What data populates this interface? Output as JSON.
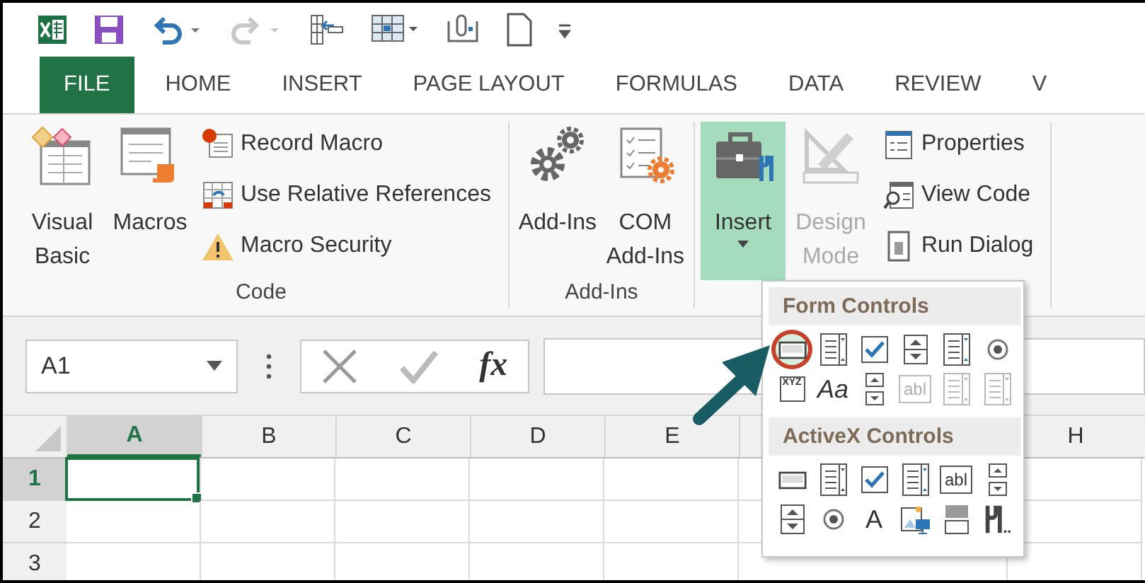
{
  "quick_access": [
    {
      "kind": "excel-logo",
      "disabled": false
    },
    {
      "kind": "save",
      "disabled": false
    },
    {
      "kind": "undo",
      "disabled": false
    },
    {
      "kind": "redo",
      "disabled": true
    },
    {
      "kind": "form",
      "disabled": false
    },
    {
      "kind": "table",
      "disabled": false
    },
    {
      "kind": "touch",
      "disabled": false
    },
    {
      "kind": "new-document",
      "disabled": false
    },
    {
      "kind": "customize",
      "disabled": false
    }
  ],
  "ribbon_tabs": [
    {
      "label": "FILE",
      "kind": "file"
    },
    {
      "label": "HOME",
      "kind": "tab"
    },
    {
      "label": "INSERT",
      "kind": "tab"
    },
    {
      "label": "PAGE LAYOUT",
      "kind": "tab"
    },
    {
      "label": "FORMULAS",
      "kind": "tab"
    },
    {
      "label": "DATA",
      "kind": "tab"
    },
    {
      "label": "REVIEW",
      "kind": "tab"
    },
    {
      "label": "V",
      "kind": "tab"
    }
  ],
  "groups": [
    {
      "label": "Code",
      "large_buttons": [
        {
          "label": "Visual Basic",
          "kind": "visual-basic",
          "selected": false,
          "disabled": false,
          "has_menu": false
        },
        {
          "label": "Macros",
          "kind": "macros",
          "selected": false,
          "disabled": false,
          "has_menu": false
        }
      ],
      "small_buttons": [
        {
          "label": "Record Macro",
          "kind": "record"
        },
        {
          "label": "Use Relative References",
          "kind": "relative"
        },
        {
          "label": "Macro Security",
          "kind": "warning"
        }
      ]
    },
    {
      "label": "Add-Ins",
      "large_buttons": [
        {
          "label": "Add-Ins",
          "kind": "gears",
          "selected": false,
          "disabled": false,
          "has_menu": false
        },
        {
          "label": "COM Add-Ins",
          "kind": "com",
          "selected": false,
          "disabled": false,
          "has_menu": false
        }
      ]
    },
    {
      "large_buttons": [
        {
          "label": "Insert",
          "kind": "toolbox",
          "selected": true,
          "disabled": false,
          "has_menu": true
        },
        {
          "label": "Design Mode",
          "kind": "design",
          "selected": false,
          "disabled": true,
          "has_menu": false
        }
      ],
      "small_buttons": [
        {
          "label": "Properties",
          "kind": "properties"
        },
        {
          "label": "View Code",
          "kind": "view-code"
        },
        {
          "label": "Run Dialog",
          "kind": "run-dialog"
        }
      ]
    }
  ],
  "name_box": {
    "value": "A1"
  },
  "formula_bar": {
    "function_label": "fx"
  },
  "columns": [
    {
      "label": "A",
      "selected": true
    },
    {
      "label": "B",
      "selected": false
    },
    {
      "label": "C",
      "selected": false
    },
    {
      "label": "D",
      "selected": false
    },
    {
      "label": "E",
      "selected": false
    },
    {
      "label": "H",
      "selected": false
    }
  ],
  "rows": [
    {
      "label": "1",
      "selected": true
    },
    {
      "label": "2",
      "selected": false
    },
    {
      "label": "3",
      "selected": false
    }
  ],
  "insert_menu": {
    "sections": [
      {
        "title": "Form Controls",
        "items": [
          {
            "kind": "button",
            "disabled": false,
            "circled": true
          },
          {
            "kind": "combo-box",
            "disabled": false,
            "circled": false
          },
          {
            "kind": "checkbox",
            "disabled": false,
            "circled": false
          },
          {
            "kind": "spin-button",
            "disabled": false,
            "circled": false
          },
          {
            "kind": "list-box",
            "disabled": false,
            "circled": false
          },
          {
            "kind": "option-button",
            "disabled": false,
            "circled": false
          },
          {
            "kind": "group-box",
            "glyph": "XYZ",
            "disabled": false,
            "circled": false
          },
          {
            "kind": "label",
            "glyph": "Aa",
            "disabled": false,
            "circled": false
          },
          {
            "kind": "scroll-bar",
            "disabled": false,
            "circled": false
          },
          {
            "kind": "text-field",
            "glyph": "abl",
            "disabled": true,
            "circled": false
          },
          {
            "kind": "combo-list",
            "disabled": true,
            "circled": false
          },
          {
            "kind": "combo-dropdown",
            "disabled": true,
            "circled": false
          }
        ]
      },
      {
        "title": "ActiveX Controls",
        "items": [
          {
            "kind": "button",
            "disabled": false,
            "circled": false
          },
          {
            "kind": "combo-box",
            "disabled": false,
            "circled": false
          },
          {
            "kind": "checkbox",
            "disabled": false,
            "circled": false
          },
          {
            "kind": "list-box",
            "disabled": false,
            "circled": false
          },
          {
            "kind": "text-field",
            "glyph": "abl",
            "disabled": false,
            "circled": false
          },
          {
            "kind": "scroll-bar",
            "disabled": false,
            "circled": false
          },
          {
            "kind": "spin-button",
            "disabled": false,
            "circled": false
          },
          {
            "kind": "option-button",
            "disabled": false,
            "circled": false
          },
          {
            "kind": "label",
            "glyph": "A",
            "disabled": false,
            "circled": false
          },
          {
            "kind": "image",
            "disabled": false,
            "circled": false
          },
          {
            "kind": "toggle-button",
            "disabled": false,
            "circled": false
          },
          {
            "kind": "more-controls",
            "disabled": false,
            "circled": false
          }
        ]
      }
    ]
  }
}
